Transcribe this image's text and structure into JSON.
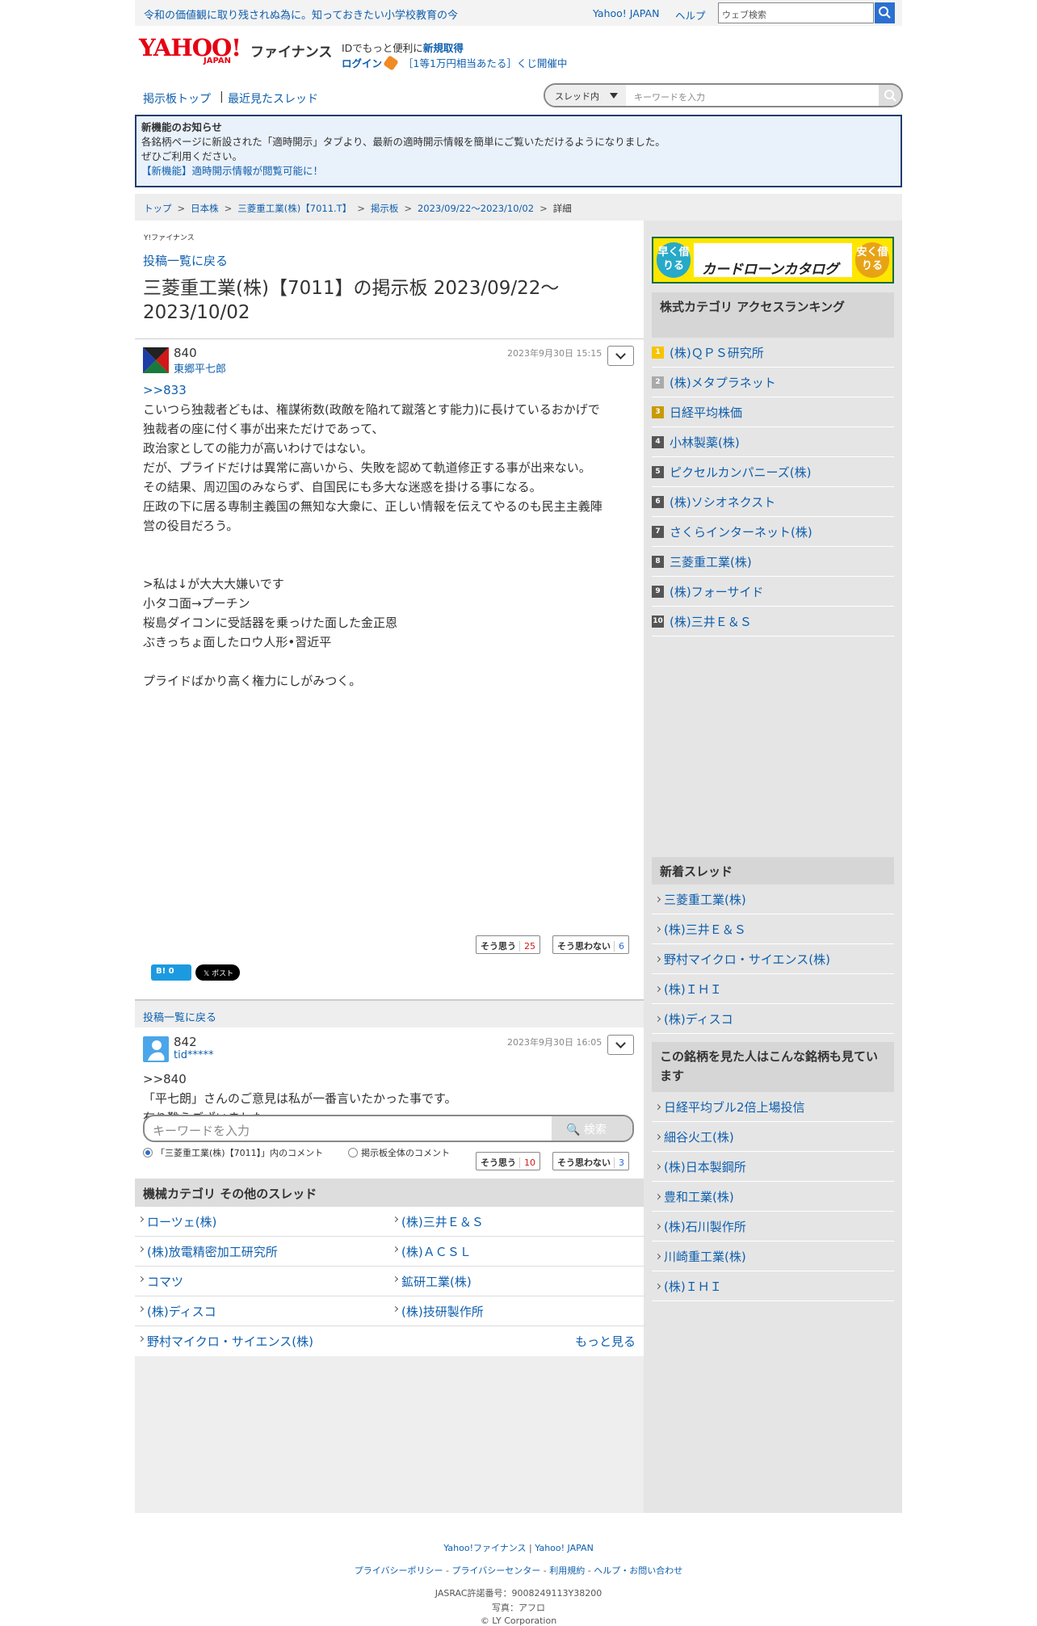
{
  "topbar": {
    "news": "令和の価値観に取り残されぬ為に。知っておきたい小学校教育の今",
    "yahoo_japan": "Yahoo! JAPAN",
    "help": "ヘルプ",
    "web_search_placeholder": "ウェブ検索"
  },
  "header": {
    "logo": "YAHOO!",
    "logo_sub": "JAPAN",
    "finance": "ファイナンス",
    "id_text": "IDでもっと便利に",
    "id_link": "新規取得",
    "login": "ログイン",
    "campaign": "［1等1万円相当あたる］くじ開催中"
  },
  "nav": {
    "board_top": "掲示板トップ",
    "sep": "|",
    "recent": "最近見たスレッド",
    "scope": "スレッド内",
    "keyword_placeholder": "キーワードを入力"
  },
  "notice": {
    "title": "新機能のお知らせ",
    "line1": "各銘柄ページに新設された「適時開示」タブより、最新の適時開示情報を簡単にご覧いただけるようになりました。",
    "line2": "ぜひご利用ください。",
    "link": "【新機能】適時開示情報が閲覧可能に！"
  },
  "breadcrumb": [
    "トップ",
    "日本株",
    "三菱重工業(株)【7011.T】",
    "掲示板",
    "2023/09/22〜2023/10/02",
    "詳細"
  ],
  "main": {
    "yf_logo": "Y!ファイナンス",
    "back": "投稿一覧に戻る",
    "title": "三菱重工業(株)【7011】の掲示板 2023/09/22〜2023/10/02",
    "posts": [
      {
        "num": "840",
        "name": "東郷平七郎",
        "date": "2023年9月30日 15:15",
        "reply": ">>833",
        "body": "こいつら独裁者どもは、権謀術数(政敵を陥れて蹴落とす能力)に長けているおかげで\n独裁者の座に付く事が出来ただけであって、\n政治家としての能力が高いわけではない。\nだが、プライドだけは異常に高いから、失敗を認めて軌道修正する事が出来ない。\nその結果、周辺国のみならず、自国民にも多大な迷惑を掛ける事になる。\n圧政の下に居る専制主義国の無知な大衆に、正しい情報を伝えてやるのも民主主義陣\n営の役目だろう。\n\n\n>私は↓が大大大嫌いです\n小タコ面→プーチン\n桜島ダイコンに受話器を乗っけた面した金正恩\nぶきっちょ面したロウ人形•習近平\n\nプライドばかり高く権力にしがみつく。",
        "agree": "そう思う",
        "agree_count": "25",
        "disagree": "そう思わない",
        "disagree_count": "6"
      },
      {
        "num": "842",
        "name": "tid*****",
        "date": "2023年9月30日 16:05",
        "reply": "",
        "body": ">>840\n「平七朗」さんのご意見は私が一番言いたかった事です。\n有り難うございました。",
        "agree": "そう思う",
        "agree_count": "10",
        "disagree": "そう思わない",
        "disagree_count": "3"
      }
    ],
    "hatena": "B! 0",
    "x_post": "𝕏 ポスト",
    "back_bar": "投稿一覧に戻る",
    "search_placeholder": "キーワードを入力",
    "search_button": "検索",
    "radio_thread": "「三菱重工業(株)【7011】」内のコメント",
    "radio_all": "掲示板全体のコメント",
    "other_title": "機械カテゴリ その他のスレッド",
    "other_threads": [
      [
        "ローツェ(株)",
        "(株)三井Ｅ＆Ｓ"
      ],
      [
        "(株)放電精密加工研究所",
        "(株)ＡＣＳＬ"
      ],
      [
        "コマツ",
        "鉱研工業(株)"
      ],
      [
        "(株)ディスコ",
        "(株)技研製作所"
      ],
      [
        "野村マイクロ・サイエンス(株)",
        ""
      ]
    ],
    "more": "もっと見る"
  },
  "side": {
    "ad": {
      "left": "早く借りる",
      "center": "カードローンカタログ",
      "right": "安く借りる"
    },
    "ranking_title": "株式カテゴリ アクセスランキング",
    "ranking": [
      "(株)ＱＰＳ研究所",
      "(株)メタプラネット",
      "日経平均株価",
      "小林製薬(株)",
      "ピクセルカンパニーズ(株)",
      "(株)ソシオネクスト",
      "さくらインターネット(株)",
      "三菱重工業(株)",
      "(株)フォーサイド",
      "(株)三井Ｅ＆Ｓ"
    ],
    "new_title": "新着スレッド",
    "new_threads": [
      "三菱重工業(株)",
      "(株)三井Ｅ＆Ｓ",
      "野村マイクロ・サイエンス(株)",
      "(株)ＩＨＩ",
      "(株)ディスコ"
    ],
    "viewed_title": "この銘柄を見た人はこんな銘柄も見ています",
    "viewed": [
      "日経平均ブル2倍上場投信",
      "細谷火工(株)",
      "(株)日本製鋼所",
      "豊和工業(株)",
      "(株)石川製作所",
      "川崎重工業(株)",
      "(株)ＩＨＩ"
    ]
  },
  "footer": {
    "finance": "Yahoo!ファイナンス",
    "sep": "|",
    "yj": "Yahoo! JAPAN",
    "privacy": "プライバシーポリシー",
    "privacy_center": "プライバシーセンター",
    "terms": "利用規約",
    "help": "ヘルプ・お問い合わせ",
    "dash": "-",
    "jasrac": "JASRAC許諾番号：9008249113Y38200",
    "photo": "写真：アフロ",
    "copy": "© LY Corporation"
  },
  "colors": {
    "link": "#0f5fad",
    "brand": "#e60013",
    "notice_border": "#1f3c6e",
    "rank1": "#f5c400",
    "rank2": "#aaaaaa",
    "rank3": "#c89a00",
    "rank_other": "#555555"
  }
}
